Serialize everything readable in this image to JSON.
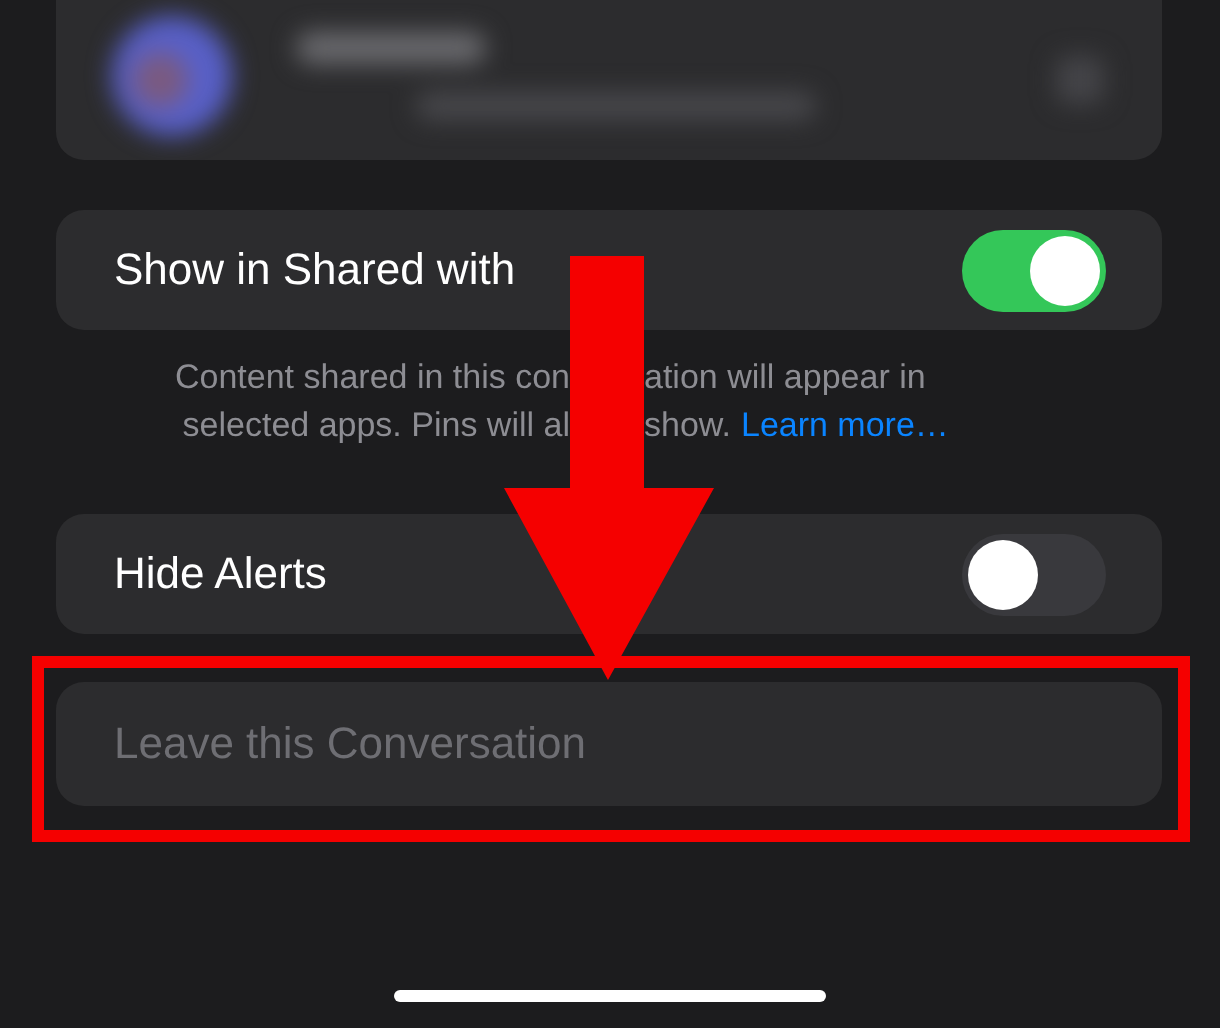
{
  "contact_card": {
    "kind": "blurred"
  },
  "shared_with_you": {
    "label": "Show in Shared with",
    "on": true
  },
  "footnote": {
    "lines": [
      {
        "left": "Content shared in this con",
        "right": "ation will appear in"
      },
      {
        "left": "selected apps. Pins will al",
        "right": "show."
      }
    ],
    "link": "Learn more…"
  },
  "hide_alerts": {
    "label": "Hide Alerts",
    "on": false
  },
  "leave_button": {
    "label": "Leave this Conversation",
    "disabled": true
  },
  "annotation": {
    "kind": "arrow_and_box"
  }
}
